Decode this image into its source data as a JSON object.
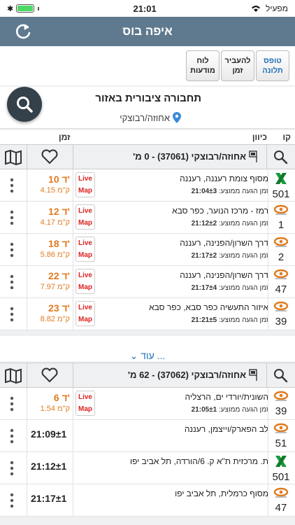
{
  "status": {
    "carrier": "מפעיל",
    "time": "21:01"
  },
  "header": {
    "title": "איפה בוס"
  },
  "toolbar": [
    {
      "label": "טופס\nתלונה",
      "blue": true
    },
    {
      "label": "להעביר\nזמן",
      "blue": false
    },
    {
      "label": "לוח\nמודעות",
      "blue": false
    }
  ],
  "search": {
    "title": "תחבורה ציבורית באזור",
    "location": "אחוזה/רבוצקי"
  },
  "columns": {
    "line": "קו",
    "direction": "כיוון",
    "time": "זמן"
  },
  "live_label": "Live Map",
  "expected_prefix": "זמן הגעה ממוצע:",
  "stops": [
    {
      "title": "אחוזה/רבוצקי (37061) - 0 מ'",
      "rows": [
        {
          "route": "501",
          "op": "x",
          "dest": "מסוף צומת רעננה, רעננה",
          "expected": "21:04±3",
          "min": "10 ד'",
          "km": "4.15 ק\"מ"
        },
        {
          "route": "1",
          "op": "eye",
          "dest": "רמז - מרכז הנוער, כפר סבא",
          "expected": "21:12±2",
          "min": "12 ד'",
          "km": "4.17 ק\"מ"
        },
        {
          "route": "2",
          "op": "eye",
          "dest": "דרך השרון/הפנינה, רעננה",
          "expected": "21:17±2",
          "min": "18 ד'",
          "km": "5.86 ק\"מ"
        },
        {
          "route": "47",
          "op": "eye",
          "dest": "דרך השרון/הפנינה, רעננה",
          "expected": "21:17±4",
          "min": "22 ד'",
          "km": "7.97 ק\"מ"
        },
        {
          "route": "39",
          "op": "eye",
          "dest": "איזור התעשיה כפר סבא, כפר סבא",
          "expected": "21:21±5",
          "min": "23 ד'",
          "km": "8.82 ק\"מ"
        }
      ]
    },
    {
      "title": "אחוזה/רבוצקי (37062) - 62 מ'",
      "rows": [
        {
          "route": "39",
          "op": "eye",
          "dest": "השונית/יורדי ים, הרצליה",
          "expected": "21:05±1",
          "min": "6 ד'",
          "km": "1.54 ק\"מ"
        },
        {
          "route": "51",
          "op": "eye",
          "dest": "לב הפארק/וייצמן, רעננה",
          "time": "21:09±1"
        },
        {
          "route": "501",
          "op": "x",
          "dest": "ת. מרכזית ת\"א ק. 6/הורדה, תל אביב יפו",
          "time": "21:12±1"
        },
        {
          "route": "47",
          "op": "eye",
          "dest": "מסוף כרמלית, תל אביב יפו",
          "time": "21:17±1"
        }
      ]
    }
  ],
  "more": {
    "label": "עוד ..."
  }
}
